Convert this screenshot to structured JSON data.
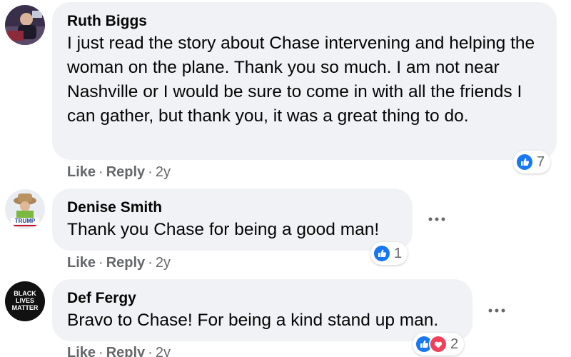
{
  "accent_color": "#1877f2",
  "love_color": "#f33e58",
  "comments": [
    {
      "author": "Ruth Biggs",
      "text": "I just read the story about Chase intervening and helping the woman on the plane. Thank you so much. I am not near Nashville or I would be sure to come in with all the friends I can gather, but thank you, it was a great thing to do.",
      "reactions": [
        "like-icon"
      ],
      "reaction_count": "7",
      "actions": {
        "like": "Like",
        "reply": "Reply",
        "time": "2y"
      },
      "separator": "·"
    },
    {
      "author": "Denise Smith",
      "text": "Thank you Chase for being a good man!",
      "reactions": [
        "like-icon"
      ],
      "reaction_count": "1",
      "actions": {
        "like": "Like",
        "reply": "Reply",
        "time": "2y"
      },
      "separator": "·"
    },
    {
      "author": "Def Fergy",
      "text": "Bravo to Chase! For being a kind stand up man.",
      "reactions": [
        "like-icon",
        "love-icon"
      ],
      "reaction_count": "2",
      "actions": {
        "like": "Like",
        "reply": "Reply",
        "time": "2y"
      },
      "separator": "·"
    }
  ],
  "avatars": {
    "denise_text": "TRUMP",
    "fergy_text": "BLACK LIVES MATTER"
  }
}
